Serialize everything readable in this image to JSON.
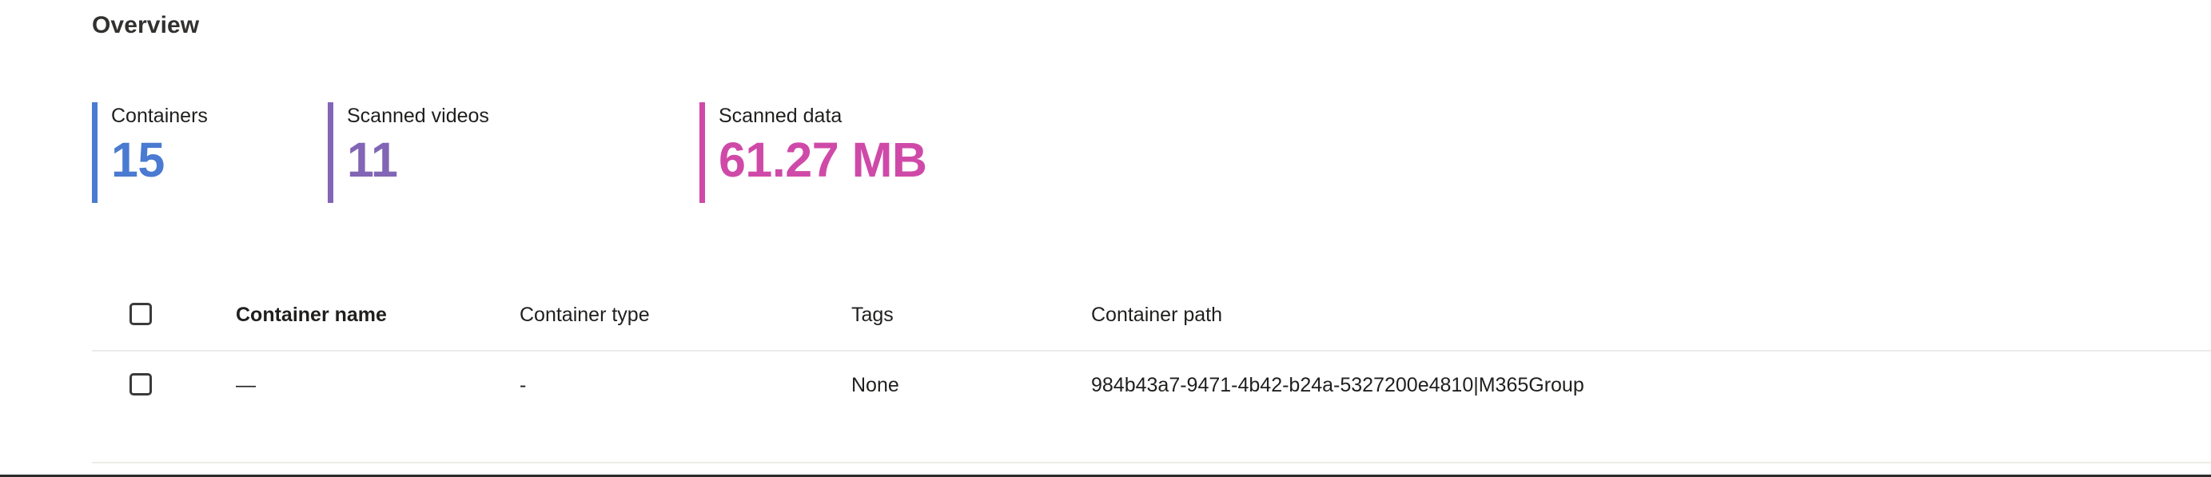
{
  "page": {
    "title": "Overview"
  },
  "metrics": [
    {
      "id": "containers",
      "label": "Containers",
      "value": "15",
      "color": "#4a7ad1"
    },
    {
      "id": "scanned-videos",
      "label": "Scanned videos",
      "value": "11",
      "color": "#8266b5"
    },
    {
      "id": "scanned-data",
      "label": "Scanned data",
      "value": "61.27 MB",
      "color": "#cf4aa8"
    }
  ],
  "table": {
    "select_all": {
      "icon": "checkbox-unchecked-icon",
      "checked": false
    },
    "columns": [
      {
        "key": "name",
        "label": "Container name",
        "bold": true
      },
      {
        "key": "type",
        "label": "Container type",
        "bold": false
      },
      {
        "key": "tags",
        "label": "Tags",
        "bold": false
      },
      {
        "key": "path",
        "label": "Container path",
        "bold": false
      }
    ],
    "rows": [
      {
        "selected": false,
        "name": "—",
        "type": "-",
        "tags": "None",
        "path": "984b43a7-9471-4b42-b24a-5327200e4810|M365Group"
      }
    ]
  },
  "colors": {
    "text": "#201f1e",
    "title": "#323130",
    "divider": "#edebe9",
    "bottom_rule": "#2b2b2b",
    "checkbox_border": "#3b3a39",
    "background": "#ffffff"
  }
}
